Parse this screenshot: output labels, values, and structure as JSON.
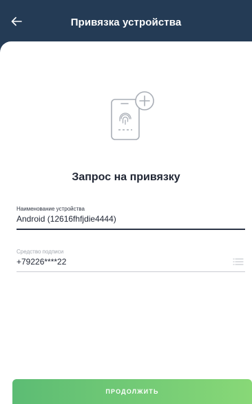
{
  "header": {
    "title": "Привязка устройства",
    "back_icon": "arrow-left-icon",
    "background_color": "#243b55"
  },
  "illustration": {
    "icon": "phone-fingerprint-add-icon"
  },
  "main": {
    "heading": "Запрос на привязку"
  },
  "fields": {
    "device_name": {
      "label": "Наименование устройства",
      "value": "Android (12616fhfjdie4444)"
    },
    "signature_method": {
      "label": "Средство подписи",
      "value": "+79226****22",
      "icon": "list-icon"
    }
  },
  "footer": {
    "continue_label": "ПРОДОЛЖИТЬ",
    "accent_start": "#5cbc74",
    "accent_end": "#88d877"
  }
}
